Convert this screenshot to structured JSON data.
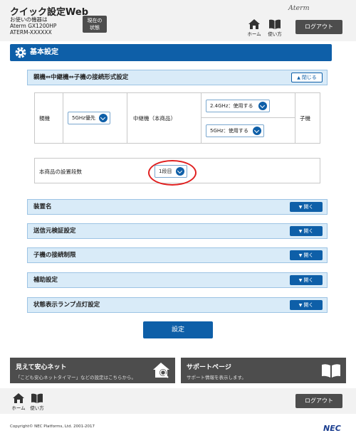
{
  "header": {
    "title": "クイック設定Web",
    "device_label": "お使いの機器は",
    "device_model": "Aterm GX1200HP",
    "device_ssid": "ATERM-XXXXXX",
    "status_label_1": "現在の",
    "status_label_2": "状態",
    "brand": "Aterm",
    "home_label": "ホーム",
    "usage_label": "使い方",
    "logout_label": "ログアウト"
  },
  "section": {
    "title": "基本設定"
  },
  "connection": {
    "title": "親機⇔中継機⇔子機の接続形式設定",
    "close_label": "閉じる",
    "parent_label": "親機",
    "parent_select": "5GHz優先",
    "relay_label": "中継機（本商品）",
    "relay_24": "2.4GHz：使用する",
    "relay_5": "5GHz：使用する",
    "child_label": "子機"
  },
  "stage": {
    "label": "本商品の設置段数",
    "value": "1段目"
  },
  "accordions": [
    {
      "title": "装置名",
      "open_label": "開く"
    },
    {
      "title": "送信元検証設定",
      "open_label": "開く"
    },
    {
      "title": "子機の接続制限",
      "open_label": "開く"
    },
    {
      "title": "補助設定",
      "open_label": "開く"
    },
    {
      "title": "状態表示ランプ点灯設定",
      "open_label": "開く"
    }
  ],
  "submit_label": "設定",
  "banners": {
    "left_title": "見えて安心ネット",
    "left_sub": "「こども安心ネットタイマー」などの設定はこちらから。",
    "right_title": "サポートページ",
    "right_sub": "サポート情報を表示します。"
  },
  "footer": {
    "home_label": "ホーム",
    "usage_label": "使い方",
    "logout_label": "ログアウト",
    "copyright": "Copyright© NEC Platforms, Ltd. 2001-2017",
    "logo": "NEC"
  }
}
